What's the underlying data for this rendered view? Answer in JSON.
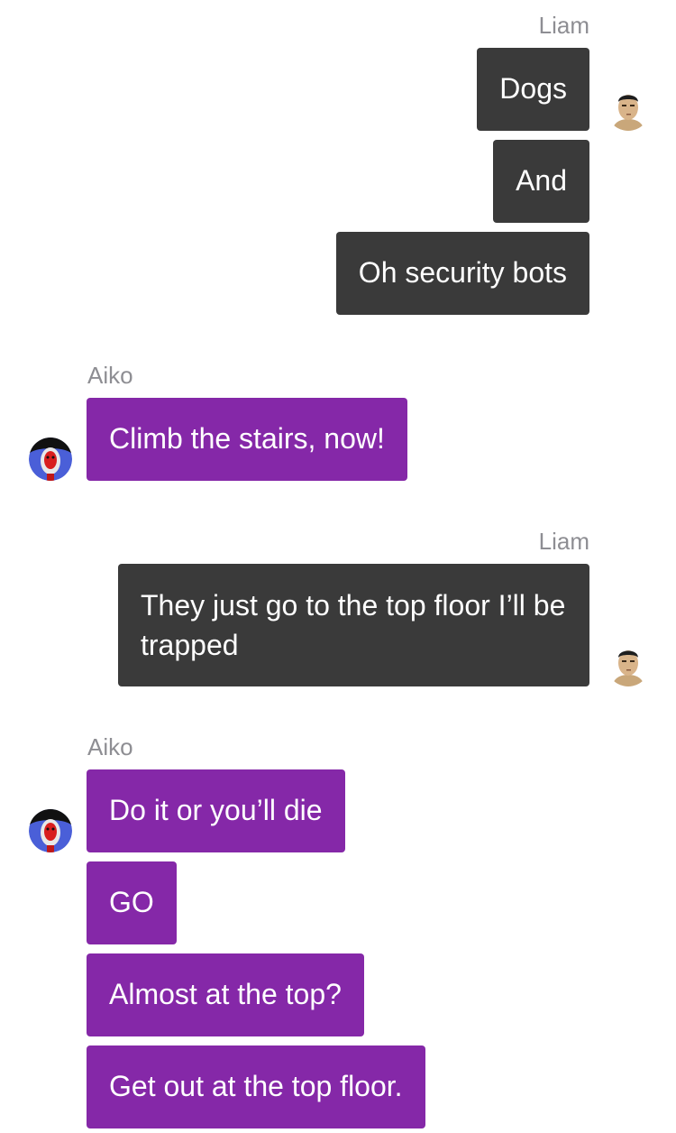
{
  "messages": [
    {
      "sender": "Liam",
      "texts": [
        "Dogs",
        "And",
        "Oh security bots"
      ]
    },
    {
      "sender": "Aiko",
      "texts": [
        "Climb the stairs, now!"
      ]
    },
    {
      "sender": "Liam",
      "texts": [
        "They just go to the top floor I’ll be trapped"
      ]
    },
    {
      "sender": "Aiko",
      "texts": [
        "Do it or you’ll die",
        "GO",
        "Almost at the top?",
        "Get out at the top floor."
      ]
    }
  ],
  "colors": {
    "outgoing_bubble": "#3a3a3a",
    "incoming_bubble": "#8528a8",
    "sender_name": "#8e8e93"
  },
  "icons": {
    "liam_avatar": "man-face-avatar",
    "aiko_avatar": "red-mask-avatar"
  }
}
